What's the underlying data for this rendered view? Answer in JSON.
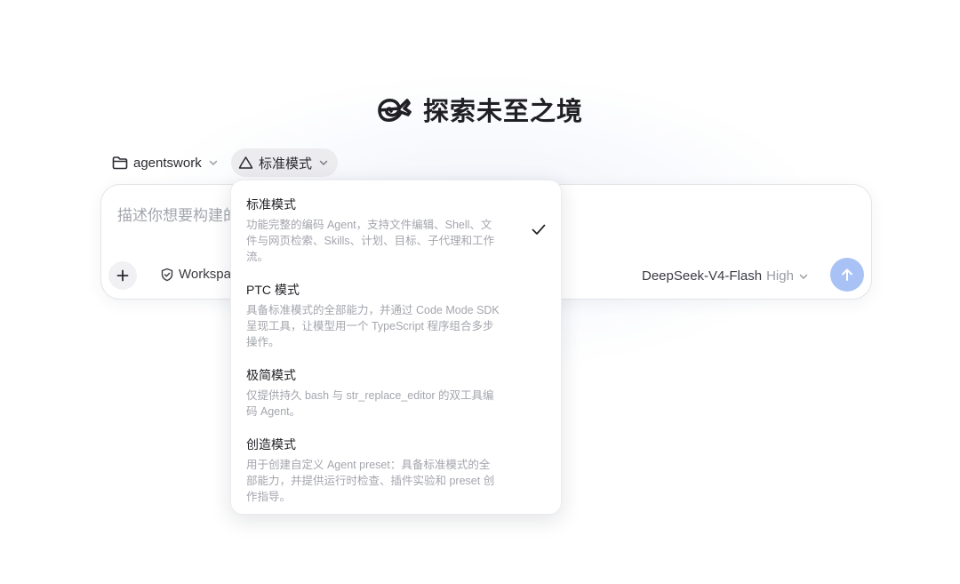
{
  "app": {
    "title": "探索未至之境",
    "logo_icon": "whale-logo-icon"
  },
  "toolbar": {
    "folder_label": "agentswork",
    "mode_label": "标准模式"
  },
  "composer": {
    "placeholder_visible": "描述你想要构建的",
    "workspace_label": "Workspa",
    "model_name": "DeepSeek-V4-Flash",
    "model_level": "High"
  },
  "mode_menu": {
    "selected_index": 0,
    "items": [
      {
        "title": "标准模式",
        "desc_lines": [
          "功能完整的编码 Agent，支持文件编辑、Shell、文",
          "件与网页检索、Skills、计划、目标、子代理和工作",
          "流。"
        ]
      },
      {
        "title": "PTC 模式",
        "desc_lines": [
          "具备标准模式的全部能力，并通过 Code Mode SDK",
          "呈现工具，让模型用一个 TypeScript 程序组合多步",
          "操作。"
        ]
      },
      {
        "title": "极简模式",
        "desc_lines": [
          "仅提供持久 bash 与 str_replace_editor 的双工具编",
          "码 Agent。"
        ]
      },
      {
        "title": "创造模式",
        "desc_lines": [
          "用于创建自定义 Agent preset：具备标准模式的全",
          "部能力，并提供运行时检查、插件实验和 preset 创",
          "作指导。"
        ]
      }
    ]
  },
  "colors": {
    "send_button": "#a9c2f5",
    "mode_chip_bg": "#ececef",
    "muted_text": "#a4a6ad"
  },
  "icons": {
    "folder": "folder-icon",
    "mode": "recycle-mode-icon",
    "chevron": "chevron-down-icon",
    "plus": "plus-icon",
    "workspace": "shield-check-icon",
    "send": "arrow-up-icon",
    "check": "checkmark-icon"
  }
}
